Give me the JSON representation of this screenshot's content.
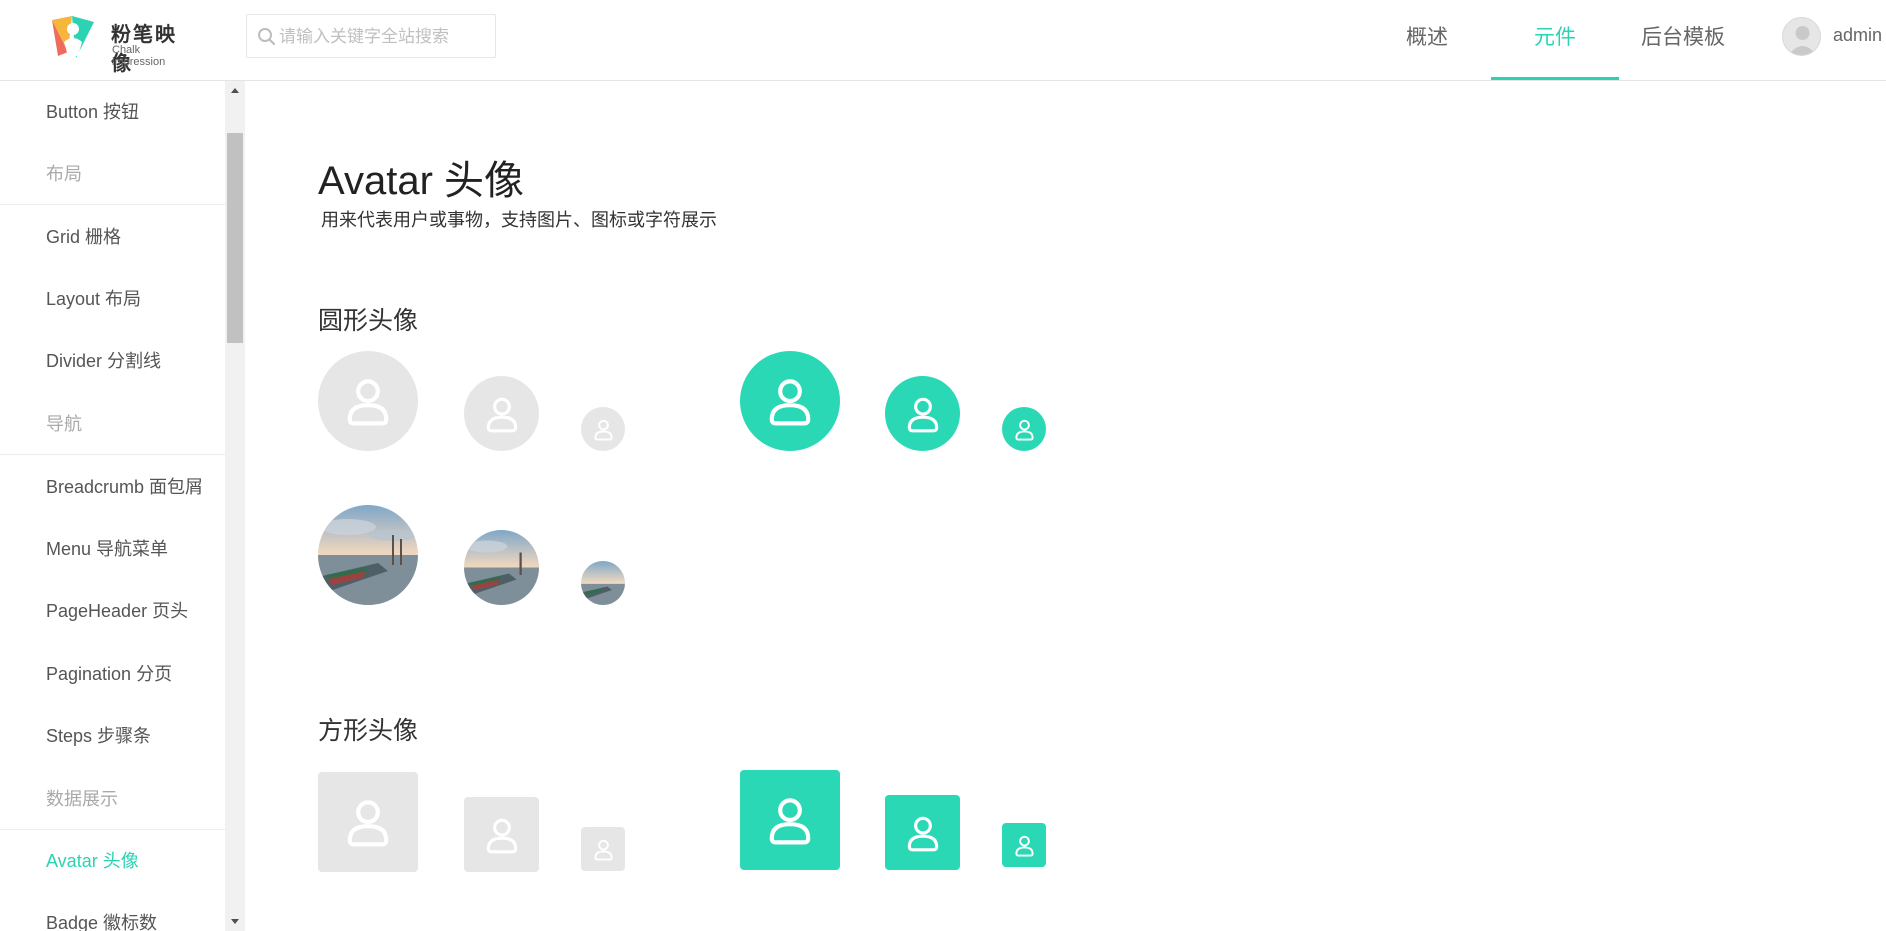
{
  "header": {
    "logo_title": "粉笔映像",
    "logo_subtitle": "Chalk impression",
    "search_placeholder": "请输入关键字全站搜索",
    "nav": [
      {
        "label": "概述"
      },
      {
        "label": "元件",
        "active": true
      },
      {
        "label": "后台模板"
      }
    ],
    "user_name": "admin",
    "accent_color": "#2bd3b2"
  },
  "sidebar": {
    "items": [
      {
        "label": "Button 按钮",
        "type": "item"
      },
      {
        "label": "布局",
        "type": "group"
      },
      {
        "label": "Grid 栅格",
        "type": "item"
      },
      {
        "label": "Layout 布局",
        "type": "item"
      },
      {
        "label": "Divider 分割线",
        "type": "item"
      },
      {
        "label": "导航",
        "type": "group"
      },
      {
        "label": "Breadcrumb 面包屑",
        "type": "item"
      },
      {
        "label": "Menu 导航菜单",
        "type": "item"
      },
      {
        "label": "PageHeader 页头",
        "type": "item"
      },
      {
        "label": "Pagination 分页",
        "type": "item"
      },
      {
        "label": "Steps 步骤条",
        "type": "item"
      },
      {
        "label": "数据展示",
        "type": "group"
      },
      {
        "label": "Avatar 头像",
        "type": "item",
        "active": true
      },
      {
        "label": "Badge 徽标数",
        "type": "item"
      }
    ]
  },
  "main": {
    "title": "Avatar 头像",
    "description": "用来代表用户或事物，支持图片、图标或字符展示",
    "sections": [
      {
        "heading": "圆形头像"
      },
      {
        "heading": "方形头像"
      }
    ],
    "avatar_colors": {
      "gray": "#e6e6e6",
      "teal": "#2bd8b6"
    }
  }
}
